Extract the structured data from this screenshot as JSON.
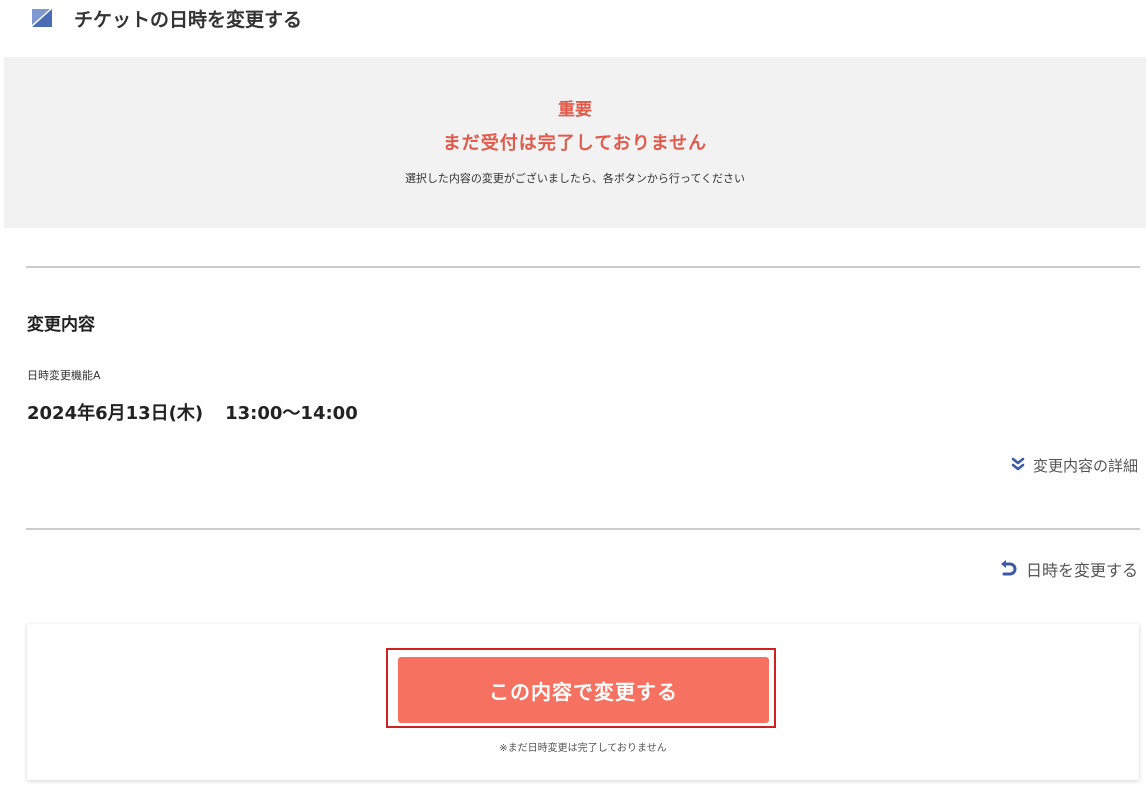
{
  "header": {
    "title": "チケットの日時を変更する",
    "mark_color": "#4a6db5"
  },
  "notice": {
    "important": "重要",
    "headline": "まだ受付は完了しておりません",
    "message": "選択した内容の変更がございましたら、各ボタンから行ってください",
    "accent_color": "#e05a4b"
  },
  "change": {
    "heading": "変更内容",
    "feature_name": "日時変更機能A",
    "date": "2024年6月13日(木)",
    "time": "13:00～14:00",
    "detail_link": "変更内容の詳細",
    "detail_icon": "double-chevron-down-icon"
  },
  "actions": {
    "change_datetime_link": "日時を変更する",
    "change_datetime_icon": "undo-arrow-icon",
    "confirm_button": "この内容で変更する",
    "confirm_note": "※まだ日時変更は完了しておりません",
    "button_color": "#f77160",
    "icon_color": "#3a5aa8"
  }
}
